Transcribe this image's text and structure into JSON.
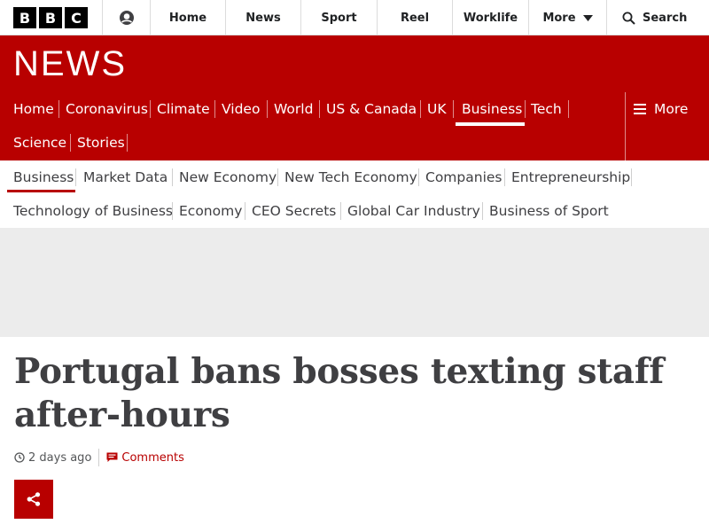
{
  "global_bar": {
    "logo_letters": [
      "B",
      "B",
      "C"
    ],
    "account_icon": "user-icon",
    "nav": [
      "Home",
      "News",
      "Sport",
      "Reel",
      "Worklife"
    ],
    "more_label": "More",
    "search_label": "Search"
  },
  "banner": {
    "title": "NEWS",
    "color": "#b80000"
  },
  "primary_nav": {
    "items": [
      "Home",
      "Coronavirus",
      "Climate",
      "Video",
      "World",
      "US & Canada",
      "UK",
      "Business",
      "Tech",
      "Science",
      "Stories"
    ],
    "active": "Business",
    "more_label": "More"
  },
  "secondary_nav": {
    "items": [
      "Business",
      "Market Data",
      "New Economy",
      "New Tech Economy",
      "Companies",
      "Entrepreneurship",
      "Technology of Business",
      "Economy",
      "CEO Secrets",
      "Global Car Industry",
      "Business of Sport"
    ],
    "active": "Business"
  },
  "article": {
    "headline": "Portugal bans bosses texting staff after-hours",
    "timestamp": "2 days ago",
    "comments_label": "Comments",
    "share_icon": "share-icon"
  }
}
